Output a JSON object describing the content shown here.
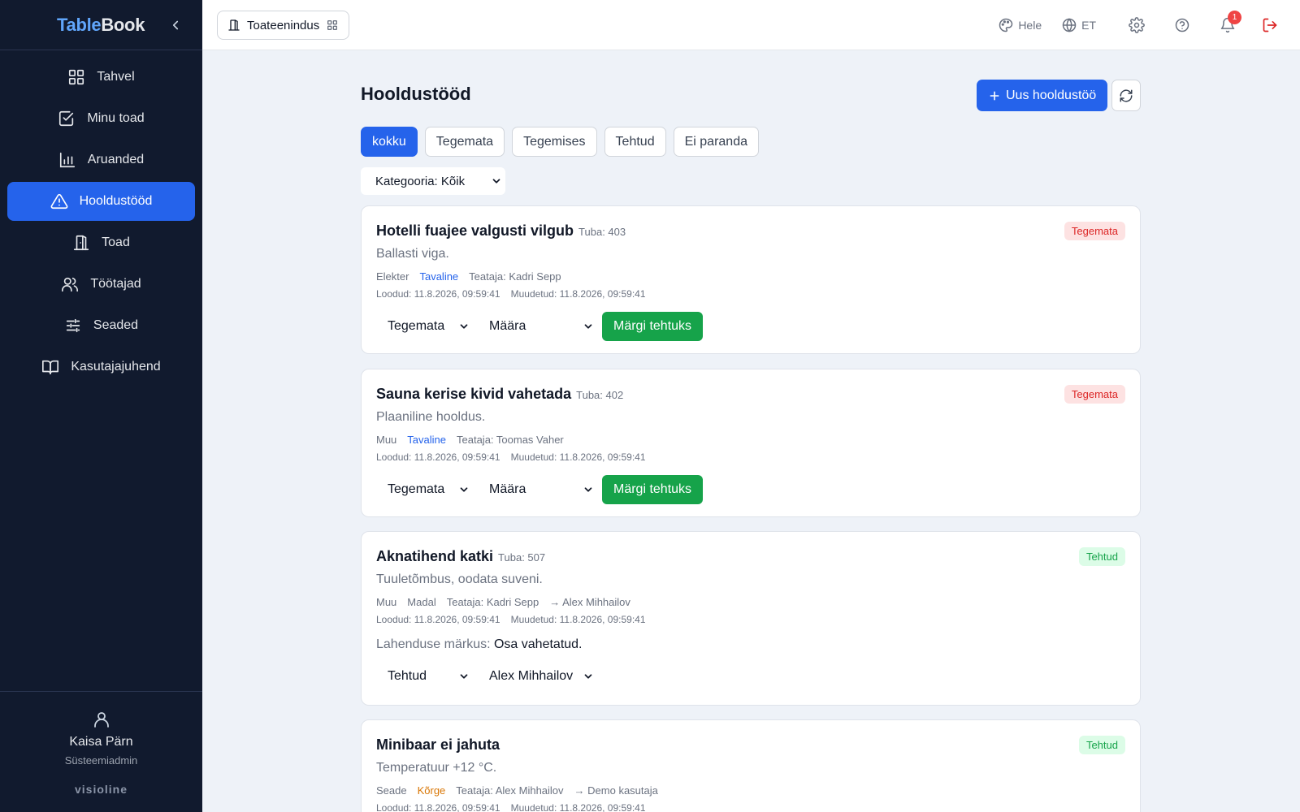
{
  "brand": {
    "part1": "Table",
    "part2": "Book"
  },
  "sidebar": {
    "items": [
      {
        "label": "Tahvel",
        "icon": "grid-icon"
      },
      {
        "label": "Minu toad",
        "icon": "checkbox-icon"
      },
      {
        "label": "Aruanded",
        "icon": "bar-chart-icon"
      },
      {
        "label": "Hooldustööd",
        "icon": "warning-triangle-icon",
        "active": true
      },
      {
        "label": "Toad",
        "icon": "door-icon"
      },
      {
        "label": "Töötajad",
        "icon": "users-icon"
      },
      {
        "label": "Seaded",
        "icon": "sliders-icon"
      },
      {
        "label": "Kasutajajuhend",
        "icon": "book-icon"
      }
    ],
    "user": {
      "name": "Kaisa Pärn",
      "role": "Süsteemiadmin"
    },
    "vendor": "visioline"
  },
  "topbar": {
    "location": "Toateenindus",
    "theme": "Hele",
    "language": "ET",
    "notification_count": "1"
  },
  "main": {
    "title": "Hooldustööd",
    "new_button": "Uus hooldustöö",
    "filters": [
      "kokku",
      "Tegemata",
      "Tegemises",
      "Tehtud",
      "Ei paranda"
    ],
    "active_filter": "kokku",
    "category_select": "Kategooria: Kõik",
    "resolution_label": "Lahenduse märkus:",
    "mark_done_label": "Märgi tehtuks",
    "tasks": [
      {
        "title": "Hotelli fuajee valgusti vilgub",
        "room": "Tuba: 403",
        "status": "Tegemata",
        "description": "Ballasti viga.",
        "category": "Elekter",
        "priority": "Tavaline",
        "reporter": "Teataja: Kadri Sepp",
        "assignee": "",
        "created": "Loodud: 11.8.2026, 09:59:41",
        "modified": "Muudetud: 11.8.2026, 09:59:41",
        "status_select": "Tegemata",
        "assign_select": "Määra"
      },
      {
        "title": "Sauna kerise kivid vahetada",
        "room": "Tuba: 402",
        "status": "Tegemata",
        "description": "Plaaniline hooldus.",
        "category": "Muu",
        "priority": "Tavaline",
        "reporter": "Teataja: Toomas Vaher",
        "assignee": "",
        "created": "Loodud: 11.8.2026, 09:59:41",
        "modified": "Muudetud: 11.8.2026, 09:59:41",
        "status_select": "Tegemata",
        "assign_select": "Määra"
      },
      {
        "title": "Aknatihend katki",
        "room": "Tuba: 507",
        "status": "Tehtud",
        "description": "Tuuletõmbus, oodata suveni.",
        "category": "Muu",
        "priority": "Madal",
        "reporter": "Teataja: Kadri Sepp",
        "assignee": "→ Alex Mihhailov",
        "created": "Loodud: 11.8.2026, 09:59:41",
        "modified": "Muudetud: 11.8.2026, 09:59:41",
        "resolution": "Osa vahetatud.",
        "status_select": "Tehtud",
        "assign_select": "Alex Mihhailov"
      },
      {
        "title": "Minibaar ei jahuta",
        "room": "",
        "status": "Tehtud",
        "description": "Temperatuur +12 °C.",
        "category": "Seade",
        "priority": "Kõrge",
        "reporter": "Teataja: Alex Mihhailov",
        "assignee": "→ Demo kasutaja",
        "created": "Loodud: 11.8.2026, 09:59:41",
        "modified": "Muudetud: 11.8.2026, 09:59:41"
      }
    ]
  },
  "colors": {
    "sidebar_bg": "#111a2e",
    "accent": "#2563eb",
    "success": "#16a34a",
    "danger": "#dc2626",
    "warning": "#d97706"
  }
}
